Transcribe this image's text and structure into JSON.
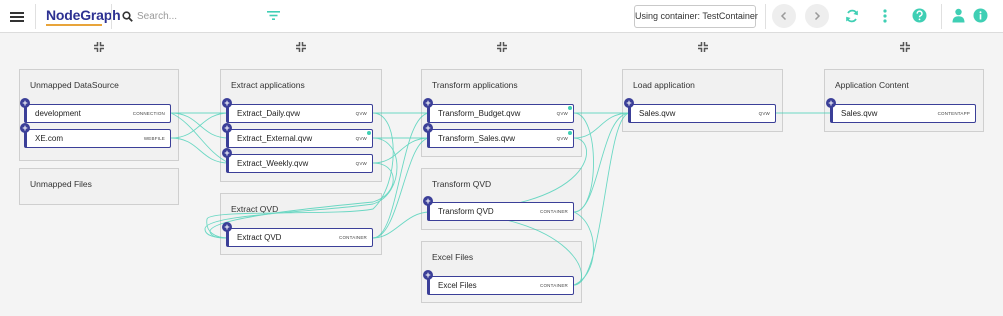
{
  "app": {
    "logo": "NodeGraph"
  },
  "search": {
    "placeholder": "Search..."
  },
  "toolbar": {
    "container_label": "Using container: TestContainer",
    "icons": [
      "menu-icon",
      "search-icon",
      "filter-icon",
      "back-icon",
      "forward-icon",
      "refresh-icon",
      "more-vert-icon",
      "help-icon",
      "user-icon",
      "info-icon"
    ]
  },
  "colors": {
    "brand": "#2d3192",
    "node_border": "#3b3f98",
    "link": "#3fcfb4",
    "accent": "#3fcfb4"
  },
  "groups": {
    "unmapped_datasource": {
      "title": "Unmapped DataSource",
      "nodes": [
        {
          "label": "development",
          "type": "CONNECTION"
        },
        {
          "label": "XE.com",
          "type": "WEBFILE"
        }
      ]
    },
    "unmapped_files": {
      "title": "Unmapped Files"
    },
    "extract_applications": {
      "title": "Extract applications",
      "nodes": [
        {
          "label": "Extract_Daily.qvw",
          "type": "QVW"
        },
        {
          "label": "Extract_External.qvw",
          "type": "QVW"
        },
        {
          "label": "Extract_Weekly.qvw",
          "type": "QVW"
        }
      ]
    },
    "extract_qvd": {
      "title": "Extract QVD",
      "nodes": [
        {
          "label": "Extract QVD",
          "type": "CONTAINER"
        }
      ]
    },
    "transform_applications": {
      "title": "Transform applications",
      "nodes": [
        {
          "label": "Transform_Budget.qvw",
          "type": "QVW"
        },
        {
          "label": "Transform_Sales.qvw",
          "type": "QVW"
        }
      ]
    },
    "transform_qvd": {
      "title": "Transform QVD",
      "nodes": [
        {
          "label": "Transform QVD",
          "type": "CONTAINER"
        }
      ]
    },
    "excel_files": {
      "title": "Excel Files",
      "nodes": [
        {
          "label": "Excel Files",
          "type": "CONTAINER"
        }
      ]
    },
    "load_application": {
      "title": "Load application",
      "nodes": [
        {
          "label": "Sales.qvw",
          "type": "QVW"
        }
      ]
    },
    "application_content": {
      "title": "Application Content",
      "nodes": [
        {
          "label": "Sales.qvw",
          "type": "CONTENTAPP"
        }
      ]
    }
  }
}
